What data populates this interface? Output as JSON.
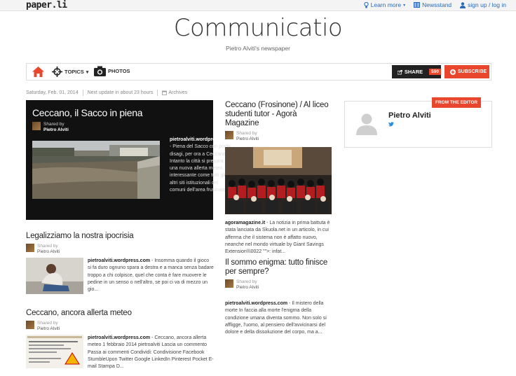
{
  "topbar": {
    "logo": "paper.li",
    "learn_more": "Learn more",
    "newsstand": "Newsstand",
    "signup": "sign up / log in"
  },
  "header": {
    "title": "Communicatio",
    "subtitle": "Pietro Alviti's newspaper"
  },
  "nav": {
    "topics": "TOPICS",
    "photos": "PHOTOS",
    "share": "SHARE",
    "share_count": "590",
    "subscribe": "SUBSCRIBE"
  },
  "meta": {
    "date": "Saturday, Feb. 01, 2014",
    "next_update": "Next update in about 23 hours",
    "archives": "Archives"
  },
  "featured": {
    "title": "Ceccano, il Sacco in piena",
    "shared_by": "Shared by",
    "author": "Pietro Alviti",
    "source": "pietroalviti.wordpress.com",
    "body": " - Piena del Sacco con pochi disagi, per ora a Ceccano. Intanto la città si prepara per una nuova allerta meteo. E' interessante come tutti gli altri siti istituzionali dei comuni dell'area frusinate ..."
  },
  "articles": [
    {
      "title": "Legalizziamo la nostra ipocrisia",
      "shared_by": "Shared by",
      "author": "Pietro Alviti",
      "source": "pietroalviti.wordpress.com",
      "body": " - Insomma quando il gioco si fa duro ognuno spara a destra e a manca senza badare troppo a chi colpisce, quel che conta è fare muovere le pedine in un senso o nell'altro, se poi ci va di mezzo un gio..."
    },
    {
      "title": "Ceccano, ancora allerta meteo",
      "shared_by": "Shared by",
      "author": "Pietro Alviti",
      "source": "pietroalviti.wordpress.com",
      "body": " - Ceccano, ancora allerta meteo 1 febbraio 2014 pietroalviti Lascia un commento Passa ai commenti Condividi: Condivisione Facebook StumbleUpon Twitter Google LinkedIn Pinterest Pocket E-mail Stampa D..."
    },
    {
      "title": "Ceccano (Frosinone) / Al liceo studenti tutor - Agorà Magazine",
      "shared_by": "Shared by",
      "author": "Pietro Alviti",
      "source": "agoramagazine.it",
      "body": " - La notizia in prima battuta è stata lanciata da Skuola.net in un articolo, in cui afferma che il sistema non è affatto nuovo, neanche nel mondo virtuale by Giant Savings Extension\\\\\\0022 \"\">: infat..."
    },
    {
      "title": "Il sommo enigma: tutto finisce per sempre?",
      "shared_by": "Shared by",
      "author": "Pietro Alviti",
      "source": "pietroalviti.wordpress.com",
      "body": " - Il mistero della morte In faccia alla morte l'enigma della condizione umana diventa sommo. Non solo si affligge, l'uomo, al pensiero dell'avvicinarsi del dolore e della dissoluzione del corpo, ma a..."
    }
  ],
  "sidebar": {
    "badge": "FROM THE EDITOR",
    "editor_name": "Pietro Alviti"
  },
  "colors": {
    "accent": "#e8472e",
    "link": "#2a6ab8",
    "dark": "#111111"
  }
}
